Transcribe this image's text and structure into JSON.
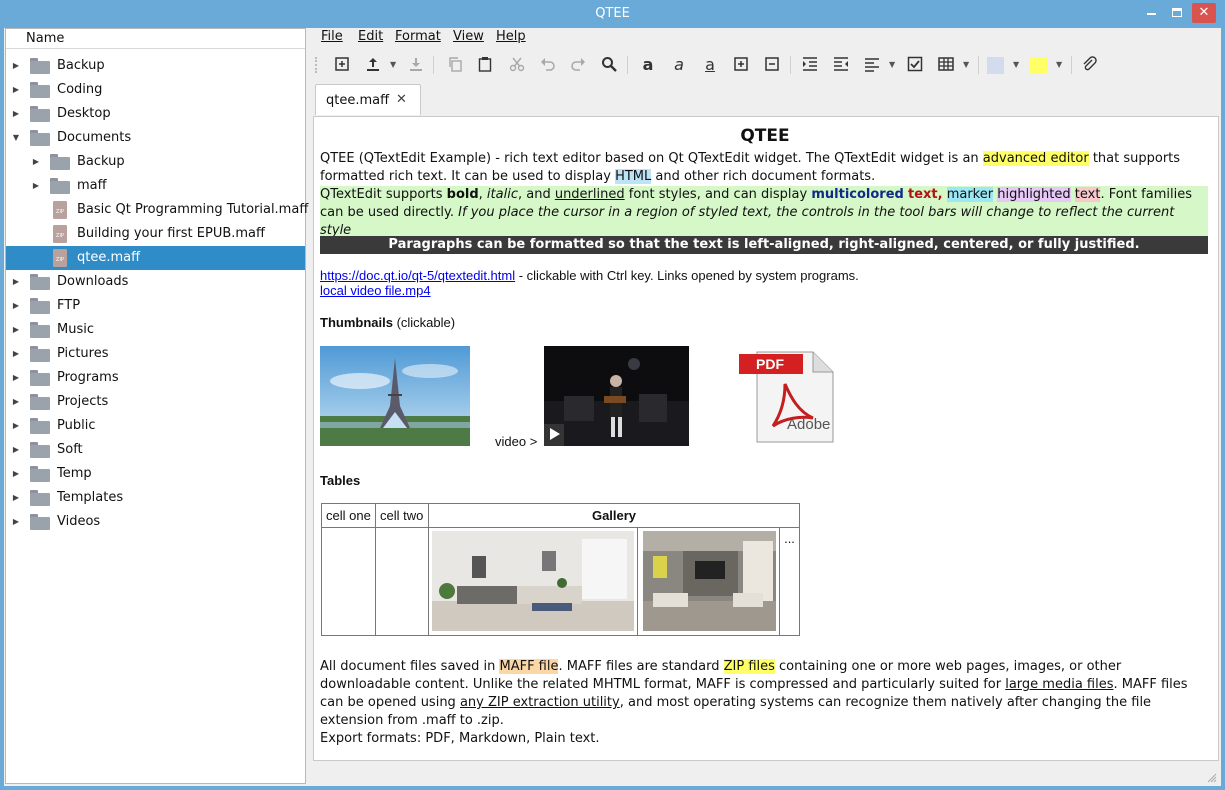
{
  "window": {
    "title": "QTEE"
  },
  "sidebar": {
    "header": "Name",
    "items": [
      {
        "label": "Backup",
        "level": 0,
        "expanded": false,
        "type": "folder"
      },
      {
        "label": "Coding",
        "level": 0,
        "expanded": false,
        "type": "folder"
      },
      {
        "label": "Desktop",
        "level": 0,
        "expanded": false,
        "type": "folder"
      },
      {
        "label": "Documents",
        "level": 0,
        "expanded": true,
        "type": "folder"
      },
      {
        "label": "Backup",
        "level": 1,
        "expanded": false,
        "type": "folder"
      },
      {
        "label": "maff",
        "level": 1,
        "expanded": false,
        "type": "folder"
      },
      {
        "label": "Basic Qt Programming Tutorial.maff",
        "level": 1,
        "type": "zip"
      },
      {
        "label": "Building your first EPUB.maff",
        "level": 1,
        "type": "zip"
      },
      {
        "label": "qtee.maff",
        "level": 1,
        "type": "zip",
        "selected": true
      },
      {
        "label": "Downloads",
        "level": 0,
        "expanded": false,
        "type": "folder"
      },
      {
        "label": "FTP",
        "level": 0,
        "expanded": false,
        "type": "folder"
      },
      {
        "label": "Music",
        "level": 0,
        "expanded": false,
        "type": "folder"
      },
      {
        "label": "Pictures",
        "level": 0,
        "expanded": false,
        "type": "folder"
      },
      {
        "label": "Programs",
        "level": 0,
        "expanded": false,
        "type": "folder"
      },
      {
        "label": "Projects",
        "level": 0,
        "expanded": false,
        "type": "folder"
      },
      {
        "label": "Public",
        "level": 0,
        "expanded": false,
        "type": "folder"
      },
      {
        "label": "Soft",
        "level": 0,
        "expanded": false,
        "type": "folder"
      },
      {
        "label": "Temp",
        "level": 0,
        "expanded": false,
        "type": "folder"
      },
      {
        "label": "Templates",
        "level": 0,
        "expanded": false,
        "type": "folder"
      },
      {
        "label": "Videos",
        "level": 0,
        "expanded": false,
        "type": "folder"
      }
    ],
    "zip_badge": "ZIP"
  },
  "menu": [
    "File",
    "Edit",
    "Format",
    "View",
    "Help"
  ],
  "toolbar": {
    "icons": [
      "new-document-icon",
      "upload-icon",
      "download-icon",
      "copy-icon",
      "paste-icon",
      "cut-icon",
      "undo-icon",
      "redo-icon",
      "search-icon",
      "bold-icon",
      "italic-icon",
      "underline-icon",
      "zoom-in-icon",
      "zoom-out-icon",
      "indent-icon",
      "outdent-icon",
      "align-icon",
      "checkbox-icon",
      "table-icon",
      "text-color-icon",
      "highlight-color-icon",
      "attach-icon"
    ],
    "text_color": "#d3dcee",
    "highlight_color": "#ffff66"
  },
  "tab": {
    "label": "qtee.maff",
    "close": "✕"
  },
  "doc": {
    "title": "QTEE",
    "intro_1": "QTEE (QTextEdit Example) - rich text editor based on Qt QTextEdit widget. The QTextEdit widget is an ",
    "intro_mark": "advanced editor",
    "intro_2": " that supports formatted rich text. It can be used to display ",
    "intro_html": "HTML",
    "intro_3": " and other rich document formats.",
    "styles": {
      "s1": "QTextEdit supports ",
      "bold": "bold",
      "s2": ", ",
      "italic": "italic",
      "s3": ", and ",
      "underlined": "underlined",
      "s4": " font styles, and can display ",
      "multicolored": "multicolored",
      "text": "text,",
      "marker": "marker",
      "highlighted": "highlighted",
      "text2": "text",
      "s5": ". Font families can be used directly. ",
      "cursor_note": "If you place the cursor in a region of styled text, the controls in the tool bars will change to reflect the current style"
    },
    "banner": "Paragraphs can be formatted so that the text is left-aligned, right-aligned, centered, or fully justified.",
    "link1": "https://doc.qt.io/qt-5/qtextedit.html",
    "link1_note": "  - clickable with Ctrl key.  Links opened by system programs.",
    "link2": "local video file.mp4",
    "thumbnails_heading": "Thumbnails",
    "thumbnails_note": "  (clickable)",
    "video_label": "video >",
    "pdf_label": "PDF",
    "adobe_label": "Adobe",
    "tables_heading": "Tables",
    "table": {
      "c1": "cell one",
      "c2": "cell two",
      "gallery": "Gallery",
      "more": "..."
    },
    "maff_1": "All document files saved in ",
    "maff_mark": "MAFF file",
    "maff_2": ".  MAFF files are standard ",
    "zip_mark": "ZIP files",
    "maff_3": " containing one or more web pages, images, or other downloadable content. Unlike the related MHTML format, MAFF is compressed and particularly suited for ",
    "large_media": "large media files",
    "maff_4": ". MAFF files can be opened using ",
    "any_zip": "any ZIP extraction utility",
    "maff_5": ", and most operating systems can recognize them natively after changing the file extension from .maff to .zip.",
    "export": "Export formats: PDF, Markdown, Plain text."
  }
}
